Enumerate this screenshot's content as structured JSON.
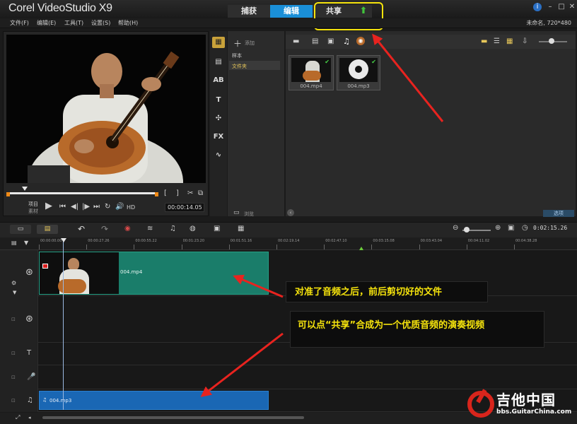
{
  "app": {
    "title": "Corel VideoStudio X9",
    "project_info": "未命名, 720*480"
  },
  "mode_tabs": {
    "capture": "捕获",
    "edit": "编辑",
    "share": "共享"
  },
  "menu": [
    "文件(F)",
    "编辑(E)",
    "工具(T)",
    "设置(S)",
    "帮助(H)"
  ],
  "player": {
    "mode_label_project": "项目",
    "mode_label_clip": "素材",
    "hd_label": "HD",
    "timecode": "00:00:14.05"
  },
  "library": {
    "add_label": "添加",
    "folders": [
      "样本",
      "文件夹"
    ],
    "browse_label": "浏览",
    "options_label": "选项",
    "items": [
      {
        "label": "004.mp4"
      },
      {
        "label": "004.mp3"
      }
    ]
  },
  "timeline": {
    "duration": "0:02:15.26",
    "ruler": [
      "00:00:00.00",
      "00:00:27.26",
      "00:00:55.22",
      "00:01:23.20",
      "00:01:51.16",
      "00:02:19.14",
      "00:02:47.10",
      "00:03:15.08",
      "00:03:43.04",
      "00:04:11.02",
      "00:04:38.28"
    ],
    "video_clip_label": "004.mp4",
    "audio_clip_label": "004.mp3"
  },
  "annotations": {
    "line1": "对准了音频之后，前后剪切好的文件",
    "line2": "可以点“共享”合成为一个优质音频的演奏视频"
  },
  "watermark": {
    "name": "吉他中国",
    "url": "bbs.GuitarChina.com"
  },
  "colors": {
    "accent_tab": "#1a8fd8",
    "video_clip": "#1a7d6a",
    "audio_clip": "#1a67b4",
    "annotation_text": "#f5e30c",
    "arrow": "#e8231f"
  }
}
